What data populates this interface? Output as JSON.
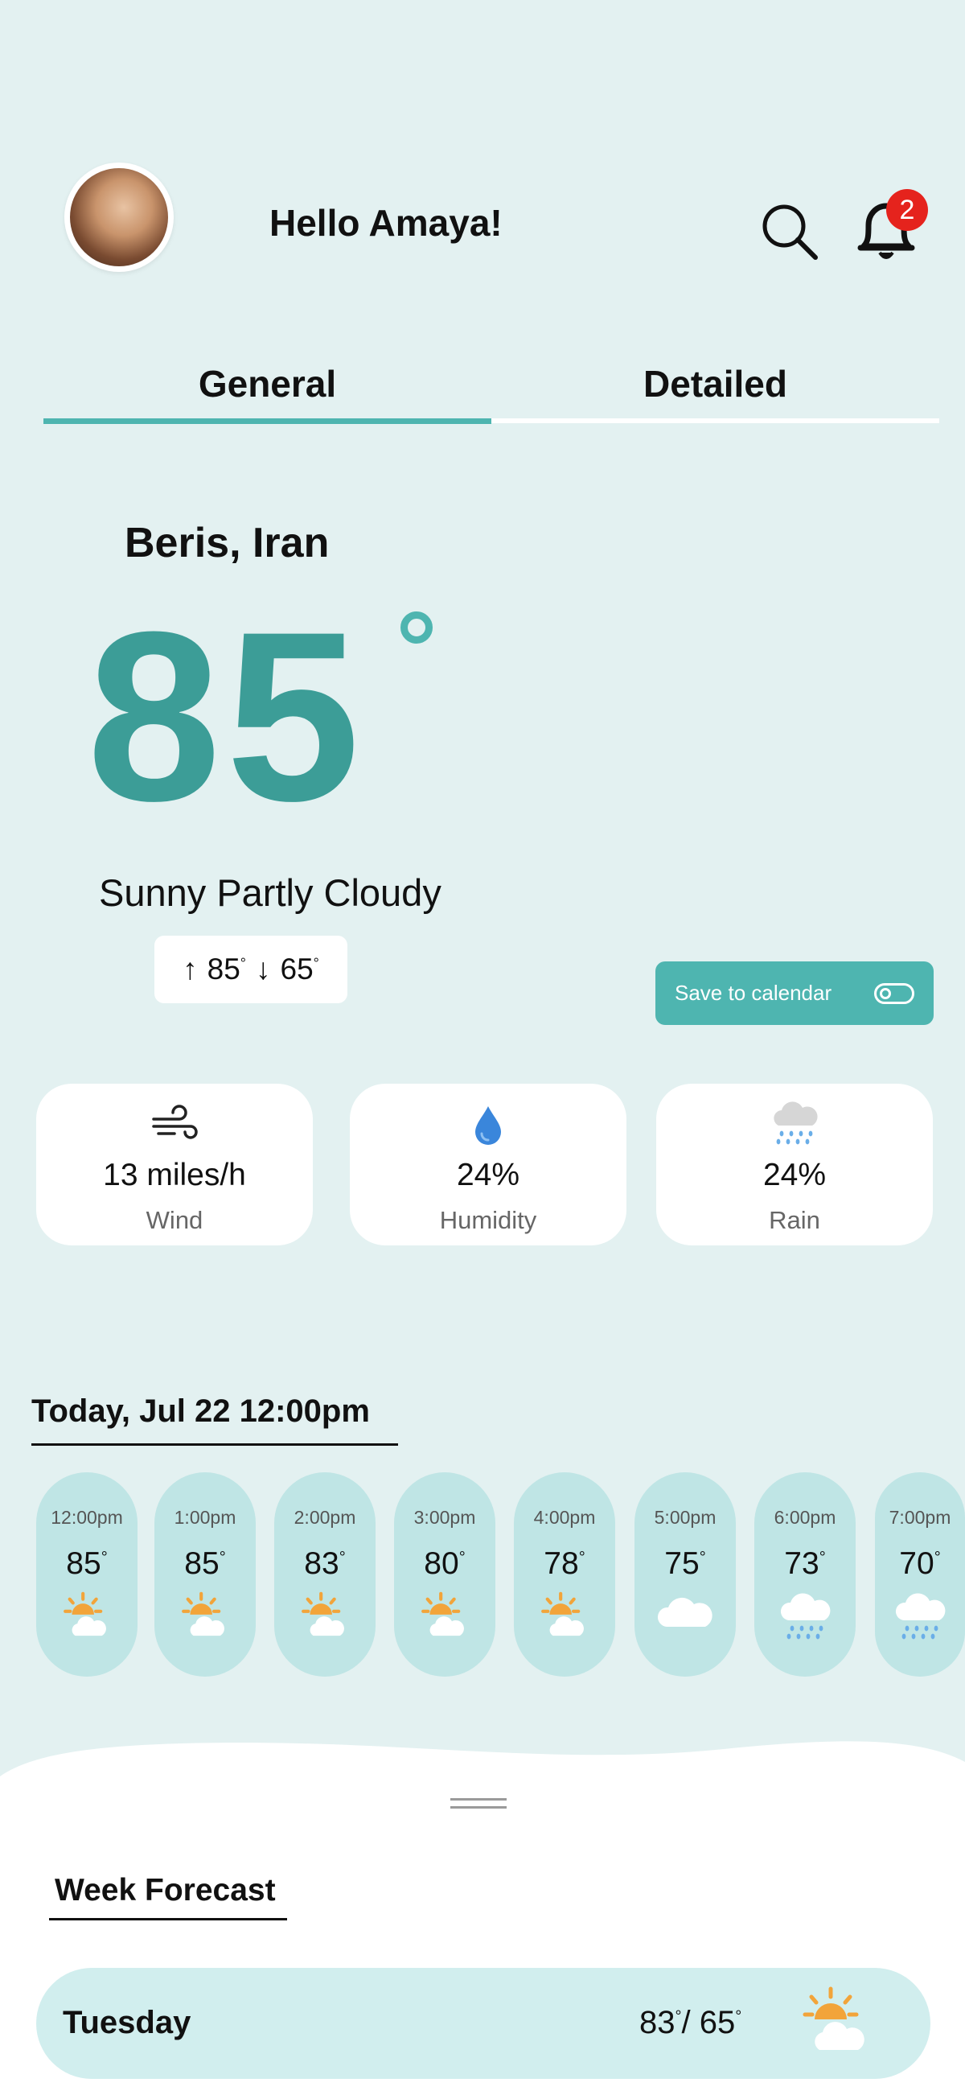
{
  "header": {
    "greeting": "Hello Amaya!",
    "notifications_count": "2"
  },
  "tabs": [
    {
      "label": "General",
      "active": true
    },
    {
      "label": "Detailed",
      "active": false
    }
  ],
  "current": {
    "location": "Beris, Iran",
    "temperature": "85",
    "condition": "Sunny Partly Cloudy",
    "high": "85",
    "low": "65"
  },
  "save_calendar": {
    "label": "Save to calendar",
    "enabled": false
  },
  "stats": [
    {
      "value": "13 miles/h",
      "label": "Wind",
      "icon": "wind-icon"
    },
    {
      "value": "24%",
      "label": "Humidity",
      "icon": "water-drop-icon"
    },
    {
      "value": "24%",
      "label": "Rain",
      "icon": "rain-cloud-icon"
    }
  ],
  "today": {
    "title": "Today, Jul 22 12:00pm",
    "hours": [
      {
        "time": "12:00pm",
        "temp": "85",
        "icon": "sun-cloud-icon"
      },
      {
        "time": "1:00pm",
        "temp": "85",
        "icon": "sun-cloud-icon"
      },
      {
        "time": "2:00pm",
        "temp": "83",
        "icon": "sun-cloud-icon"
      },
      {
        "time": "3:00pm",
        "temp": "80",
        "icon": "sun-cloud-icon"
      },
      {
        "time": "4:00pm",
        "temp": "78",
        "icon": "sun-cloud-icon"
      },
      {
        "time": "5:00pm",
        "temp": "75",
        "icon": "cloud-icon"
      },
      {
        "time": "6:00pm",
        "temp": "73",
        "icon": "rain-cloud-icon"
      },
      {
        "time": "7:00pm",
        "temp": "70",
        "icon": "rain-cloud-icon"
      }
    ]
  },
  "week": {
    "title": "Week Forecast",
    "days": [
      {
        "day": "Tuesday",
        "high": "83",
        "low": "65",
        "icon": "sun-cloud-icon"
      }
    ]
  },
  "colors": {
    "background": "#e3f1f1",
    "accent": "#4eb5b0",
    "temp": "#3c9d97",
    "pill": "#bfe5e5",
    "badge": "#e5231d"
  }
}
